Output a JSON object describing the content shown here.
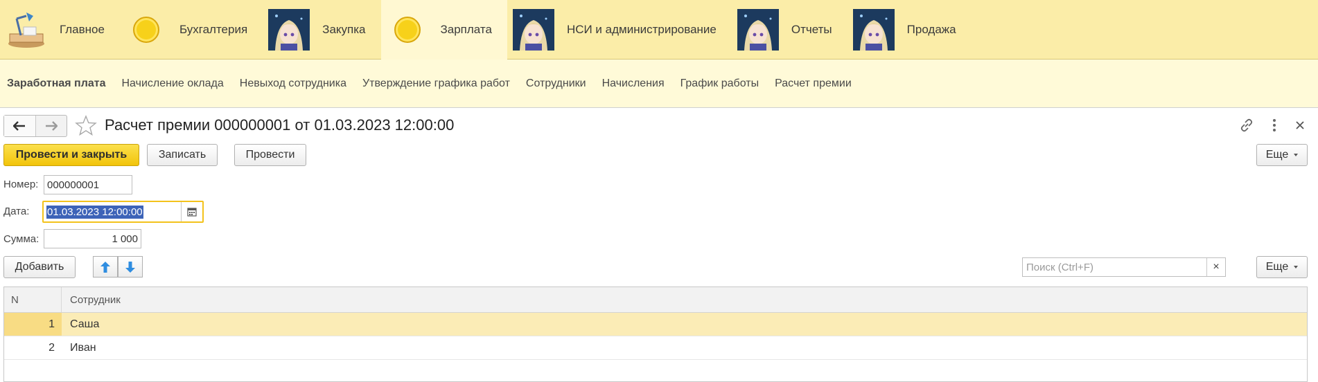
{
  "sections": [
    {
      "label": "Главное",
      "icon": "desk-lamp-icon",
      "active": false
    },
    {
      "label": "Бухгалтерия",
      "icon": "coin-icon",
      "active": false
    },
    {
      "label": "Закупка",
      "icon": "avatar-icon",
      "active": false
    },
    {
      "label": "Зарплата",
      "icon": "coin-icon",
      "active": true
    },
    {
      "label": "НСИ и администрирование",
      "icon": "avatar-icon",
      "active": false
    },
    {
      "label": "Отчеты",
      "icon": "avatar-icon",
      "active": false
    },
    {
      "label": "Продажа",
      "icon": "avatar-icon",
      "active": false
    }
  ],
  "commands": [
    {
      "label": "Заработная плата",
      "bold": true
    },
    {
      "label": "Начисление оклада"
    },
    {
      "label": "Невыход сотрудника"
    },
    {
      "label": "Утверждение графика работ"
    },
    {
      "label": "Сотрудники"
    },
    {
      "label": "Начисления"
    },
    {
      "label": "График работы"
    },
    {
      "label": "Расчет премии"
    }
  ],
  "form": {
    "title": "Расчет премии 000000001 от 01.03.2023 12:00:00",
    "buttons": {
      "post_close": "Провести и закрыть",
      "save": "Записать",
      "post": "Провести",
      "more": "Еще"
    },
    "fields": {
      "number_label": "Номер:",
      "number_value": "000000001",
      "date_label": "Дата:",
      "date_value": "01.03.2023 12:00:00",
      "sum_label": "Сумма:",
      "sum_value": "1 000"
    },
    "table_toolbar": {
      "add": "Добавить",
      "search_placeholder": "Поиск (Ctrl+F)",
      "clear": "×",
      "more": "Еще"
    },
    "table": {
      "columns": [
        "N",
        "Сотрудник"
      ],
      "rows": [
        {
          "n": "1",
          "employee": "Саша",
          "selected": true
        },
        {
          "n": "2",
          "employee": "Иван",
          "selected": false
        }
      ]
    }
  },
  "colors": {
    "sections_bg": "#fbeda8",
    "commands_bg": "#fffad8",
    "primary_button": "#f2c40b",
    "selection": "#3d63b8",
    "row_selected": "#fbecb6"
  }
}
